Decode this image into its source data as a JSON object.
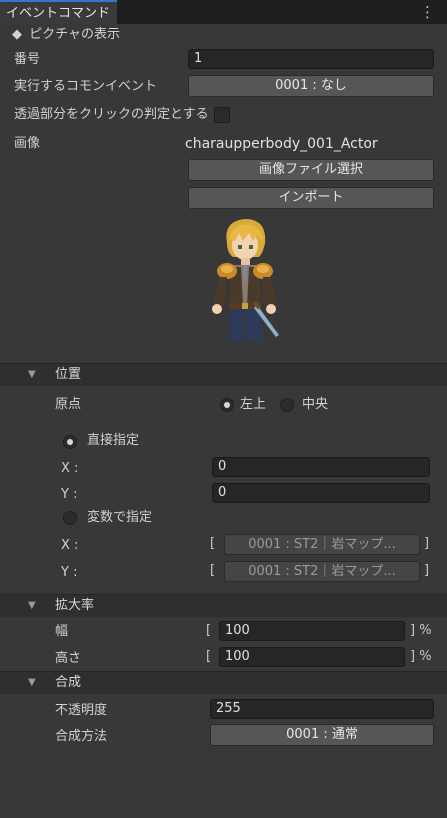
{
  "window": {
    "tab_label": "イベントコマンド",
    "menu_glyph": "⋮"
  },
  "command": {
    "diamond": "◆",
    "title": "ピクチャの表示"
  },
  "number": {
    "label": "番号",
    "value": "1"
  },
  "common_event": {
    "label": "実行するコモンイベント",
    "value": "0001 : なし"
  },
  "click_transparent": {
    "label": "透過部分をクリックの判定とする"
  },
  "image": {
    "label": "画像",
    "file_name": "charaupperbody_001_Actor",
    "select_button": "画像ファイル選択",
    "import_button": "インポート"
  },
  "position": {
    "section_label": "位置",
    "origin_label": "原点",
    "origin_options": [
      "左上",
      "中央"
    ],
    "direct_label": "直接指定",
    "x_label": "X :",
    "y_label": "Y :",
    "x_value": "0",
    "y_value": "0",
    "variable_label": "変数で指定",
    "var_x_label": "X :",
    "var_y_label": "Y :",
    "var_x_value": "0001 : ST2｜岩マップ...",
    "var_y_value": "0001 : ST2｜岩マップ...",
    "bracket_open": "[",
    "bracket_close": "]"
  },
  "scale": {
    "section_label": "拡大率",
    "width_label": "幅",
    "height_label": "高さ",
    "width_value": "100",
    "height_value": "100",
    "bracket_open": "[",
    "bracket_close": "] %"
  },
  "blend": {
    "section_label": "合成",
    "opacity_label": "不透明度",
    "opacity_value": "255",
    "mode_label": "合成方法",
    "mode_value": "0001 : 通常"
  },
  "colors": {
    "background": "#383838",
    "field": "#262626",
    "button": "#565656",
    "accent": "#3a72d8"
  }
}
